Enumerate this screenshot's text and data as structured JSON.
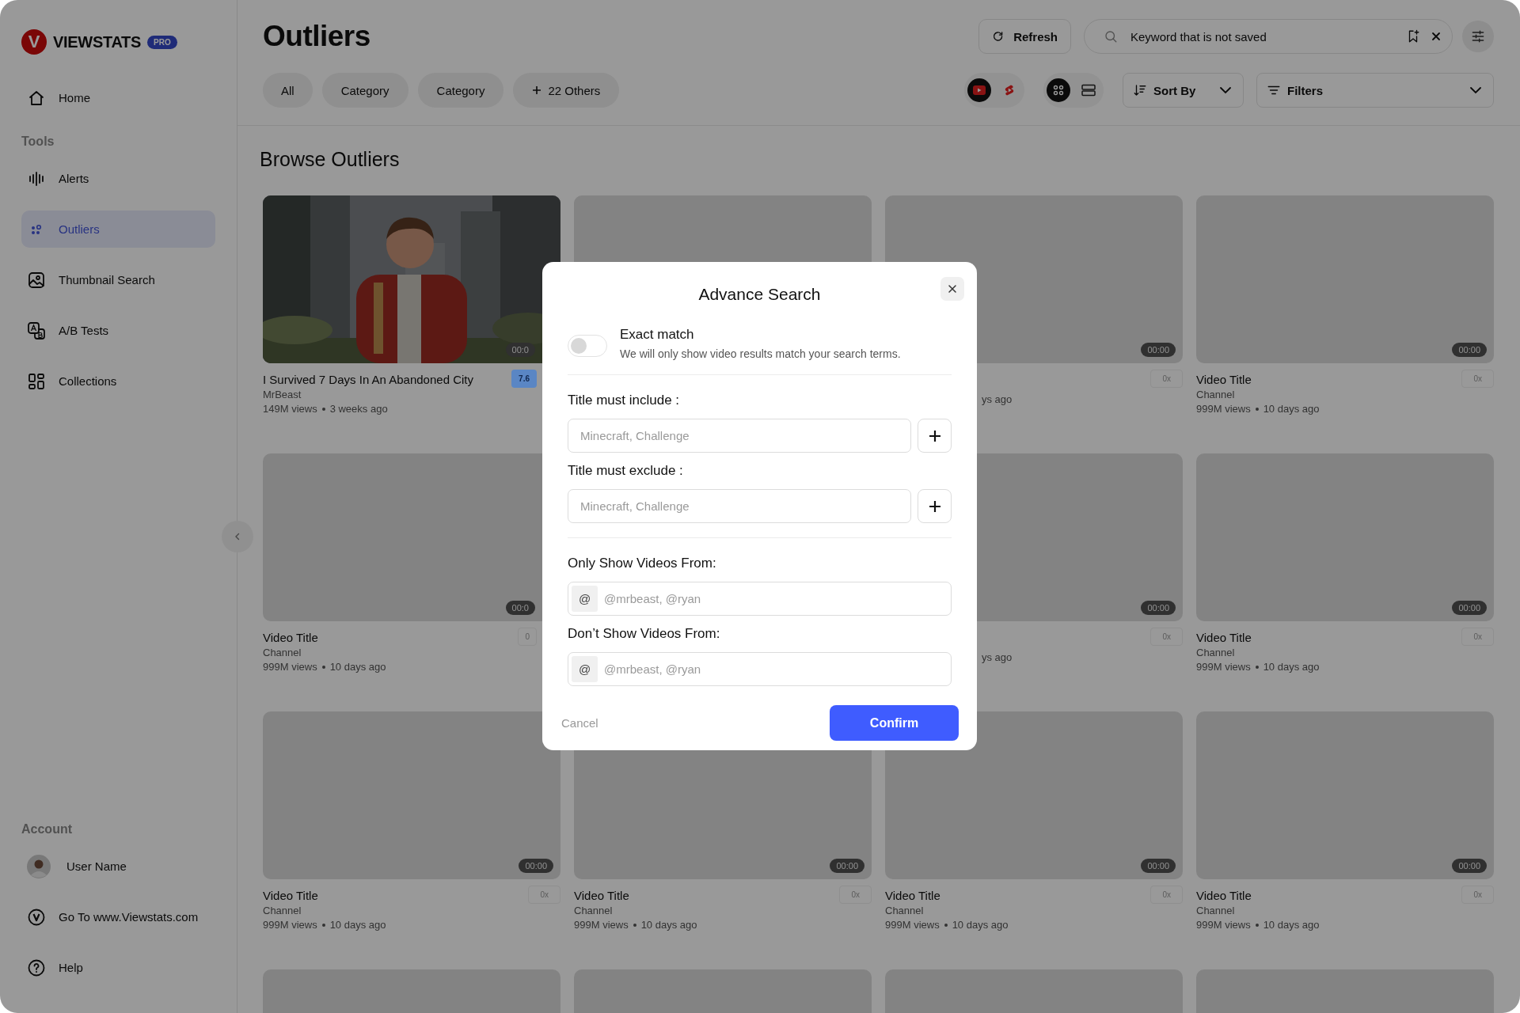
{
  "brand": {
    "logo_letter": "V",
    "name": "VIEWSTATS",
    "badge": "PRO"
  },
  "sidebar": {
    "nav": [
      {
        "kind": "home",
        "label": "Home",
        "selected": false
      }
    ],
    "tools": {
      "heading": "Tools",
      "items": [
        {
          "kind": "alerts",
          "label": "Alerts",
          "selected": false
        },
        {
          "kind": "outliers",
          "label": "Outliers",
          "selected": true
        },
        {
          "kind": "thumbnail",
          "label": "Thumbnail Search",
          "selected": false
        },
        {
          "kind": "abtest",
          "label": "A/B Tests",
          "selected": false
        },
        {
          "kind": "collections",
          "label": "Collections",
          "selected": false
        }
      ]
    },
    "account": {
      "heading": "Account",
      "items": [
        {
          "kind": "user",
          "label": "User Name"
        },
        {
          "kind": "site",
          "label": "Go To www.Viewstats.com"
        },
        {
          "kind": "help",
          "label": "Help"
        }
      ]
    }
  },
  "header": {
    "title": "Outliers",
    "refresh": "Refresh",
    "search": {
      "value": "Keyword that is not saved"
    },
    "chips": [
      {
        "kind": "plain",
        "label": "All"
      },
      {
        "kind": "plain",
        "label": "Category"
      },
      {
        "kind": "plain",
        "label": "Category"
      },
      {
        "kind": "more",
        "label": "22 Others"
      }
    ],
    "platforms": [
      {
        "kind": "youtube",
        "selected": true
      },
      {
        "kind": "shorts",
        "selected": false
      }
    ],
    "views": [
      {
        "kind": "grid",
        "selected": true
      },
      {
        "kind": "list",
        "selected": false
      }
    ],
    "sort": {
      "label": "Sort By"
    },
    "filters": {
      "label": "Filters"
    }
  },
  "section_title": "Browse Outliers",
  "grid": [
    [
      {
        "kind": "picture",
        "duration": "00:0",
        "badge": "7.6",
        "color": "#5a86c4",
        "title": "I Survived 7 Days In An Abandoned City",
        "channel": "MrBeast",
        "views": "149M views",
        "age": "3 weeks ago"
      },
      {
        "kind": "placeholder"
      },
      {
        "kind": "placeholder",
        "duration": "00:00",
        "badge": "0x",
        "age": "ys ago"
      },
      {
        "kind": "placeholder",
        "duration": "00:00",
        "badge": "0x",
        "title": "Video Title",
        "channel": "Channel",
        "views": "999M views",
        "age": "10 days ago"
      }
    ],
    [
      {
        "kind": "placeholder",
        "duration": "00:0",
        "badge": "0",
        "title": "Video Title",
        "channel": "Channel",
        "views": "999M views",
        "age": "10 days ago"
      },
      {
        "kind": "covered"
      },
      {
        "kind": "placeholder",
        "duration": "00:00",
        "badge": "0x",
        "age": "ys ago"
      },
      {
        "kind": "placeholder",
        "duration": "00:00",
        "badge": "0x",
        "title": "Video Title",
        "channel": "Channel",
        "views": "999M views",
        "age": "10 days ago"
      }
    ],
    [
      {
        "kind": "placeholder",
        "duration": "00:00",
        "badge": "0x",
        "title": "Video Title",
        "channel": "Channel",
        "views": "999M views",
        "age": "10 days ago"
      },
      {
        "kind": "placeholder",
        "duration": "00:00",
        "badge": "0x",
        "title": "Video Title",
        "channel": "Channel",
        "views": "999M views",
        "age": "10 days ago"
      },
      {
        "kind": "placeholder",
        "duration": "00:00",
        "badge": "0x",
        "title": "Video Title",
        "channel": "Channel",
        "views": "999M views",
        "age": "10 days ago"
      },
      {
        "kind": "placeholder",
        "duration": "00:00",
        "badge": "0x",
        "title": "Video Title",
        "channel": "Channel",
        "views": "999M views",
        "age": "10 days ago"
      }
    ],
    [
      {
        "kind": "placeholder"
      },
      {
        "kind": "placeholder"
      },
      {
        "kind": "placeholder"
      },
      {
        "kind": "placeholder"
      }
    ]
  ],
  "modal": {
    "title": "Advance Search",
    "exact_match": {
      "label": "Exact match",
      "description": "We will only show video results match your search terms.",
      "on": false
    },
    "fields": [
      {
        "kind": "keywords",
        "label": "Title must include :",
        "placeholder": "Minecraft, Challenge"
      },
      {
        "kind": "keywords",
        "label": "Title must exclude :",
        "placeholder": "Minecraft, Challenge"
      },
      {
        "kind": "channels",
        "label": "Only Show Videos From:",
        "prefix": "@",
        "placeholder": "@mrbeast, @ryan"
      },
      {
        "kind": "channels",
        "label": "Don’t Show Videos From:",
        "prefix": "@",
        "placeholder": "@mrbeast, @ryan"
      }
    ],
    "cancel": "Cancel",
    "confirm": "Confirm"
  }
}
